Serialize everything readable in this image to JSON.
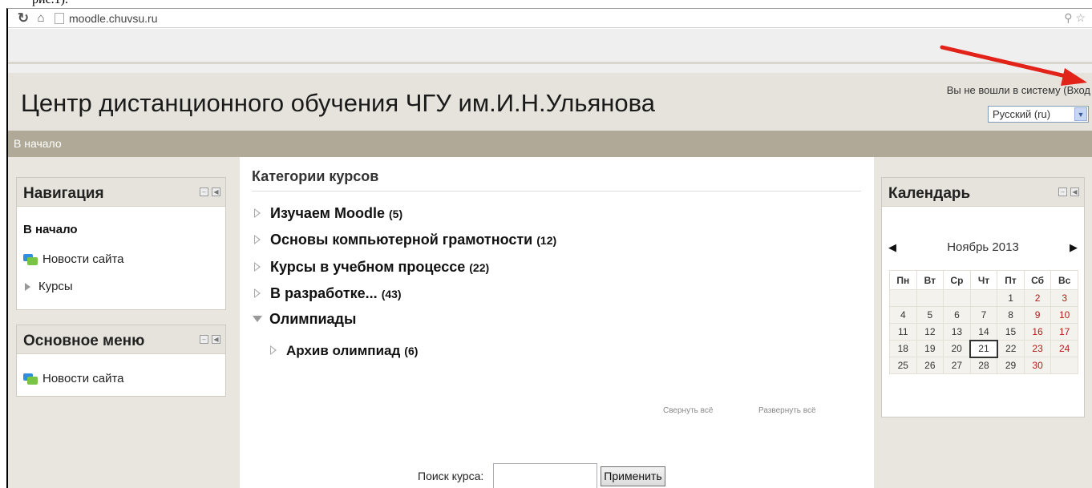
{
  "caption": "рис.1).",
  "browser": {
    "url": "moodle.chuvsu.ru"
  },
  "header": {
    "site_title": "Центр дистанционного обучения ЧГУ им.И.Н.Ульянова",
    "login_info": "Вы не вошли в систему (Вход",
    "language": "Русский (ru)"
  },
  "navbar": {
    "home": "В начало"
  },
  "navigation": {
    "title": "Навигация",
    "home": "В начало",
    "site_news": "Новости сайта",
    "courses": "Курсы"
  },
  "main_menu": {
    "title": "Основное меню",
    "site_news": "Новости сайта"
  },
  "categories": {
    "title": "Категории курсов",
    "items": [
      {
        "name": "Изучаем Moodle",
        "count": "(5)"
      },
      {
        "name": "Основы компьютерной грамотности",
        "count": "(12)"
      },
      {
        "name": "Курсы в учебном процессе",
        "count": "(22)"
      },
      {
        "name": "В разработке...",
        "count": "(43)"
      },
      {
        "name": "Олимпиады",
        "count": ""
      },
      {
        "name": "Архив олимпиад",
        "count": "(6)"
      }
    ],
    "collapse_all": "Свернуть всё",
    "expand_all": "Развернуть всё"
  },
  "search": {
    "label": "Поиск курса:",
    "value": "",
    "button": "Применить"
  },
  "calendar": {
    "title": "Календарь",
    "month": "Ноябрь 2013",
    "weekdays": [
      "Пн",
      "Вт",
      "Ср",
      "Чт",
      "Пт",
      "Сб",
      "Вс"
    ],
    "weeks": [
      [
        "",
        "",
        "",
        "",
        "1",
        "2",
        "3"
      ],
      [
        "4",
        "5",
        "6",
        "7",
        "8",
        "9",
        "10"
      ],
      [
        "11",
        "12",
        "13",
        "14",
        "15",
        "16",
        "17"
      ],
      [
        "18",
        "19",
        "20",
        "21",
        "22",
        "23",
        "24"
      ],
      [
        "25",
        "26",
        "27",
        "28",
        "29",
        "30",
        ""
      ]
    ],
    "today": "21"
  },
  "colors": {
    "navbar": "#b0a998",
    "header_bg": "#e5e3db",
    "weekend": "#b31b1b"
  }
}
